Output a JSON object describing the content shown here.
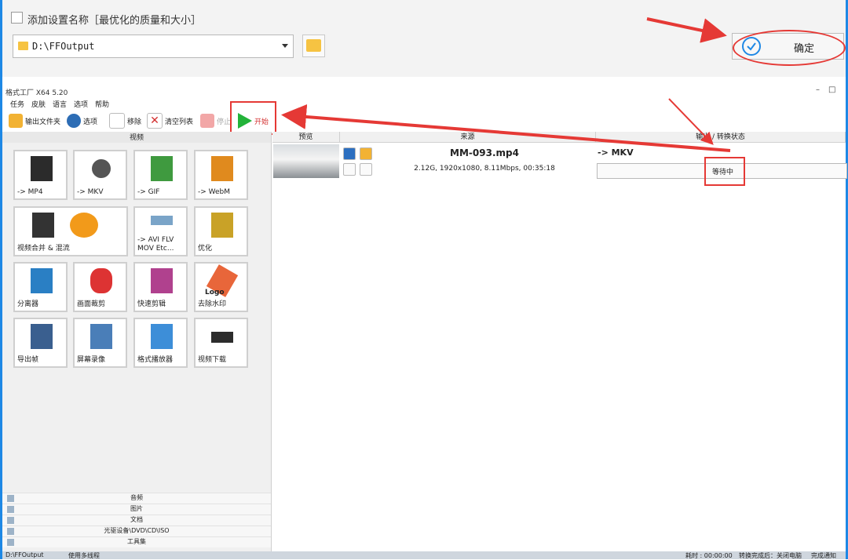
{
  "dialog": {
    "checkbox_label": "添加设置名称［最优化的质量和大小］",
    "path_value": "D:\\FFOutput",
    "ok_label": "确定"
  },
  "app": {
    "title": "格式工厂 X64 5.20",
    "win_min": "–",
    "win_max": "□",
    "menu": [
      "任务",
      "皮肤",
      "语言",
      "选项",
      "帮助"
    ],
    "toolbar": {
      "output_folder": "输出文件夹",
      "options": "选项",
      "remove": "移除",
      "clear_list": "清空列表",
      "stop": "停止",
      "start": "开始"
    },
    "left": {
      "category": "视频",
      "tiles": [
        {
          "label": "-> MP4",
          "badge": "MP4"
        },
        {
          "label": "-> MKV",
          "badge": "MKV"
        },
        {
          "label": "-> GIF",
          "badge": "GIF"
        },
        {
          "label": "-> WebM",
          "badge": "WebM"
        },
        {
          "label": "视频合并 & 混流"
        },
        {
          "label": "-> AVI FLV",
          "label2": "MOV Etc..."
        },
        {
          "label": "优化"
        },
        {
          "label": "分离器"
        },
        {
          "label": "画面裁剪"
        },
        {
          "label": "快速剪辑"
        },
        {
          "label": "去除水印",
          "badge": "Logo"
        },
        {
          "label": "导出帧"
        },
        {
          "label": "屏幕录像"
        },
        {
          "label": "格式播放器"
        },
        {
          "label": "视频下载"
        }
      ],
      "bottom_categories": [
        "音频",
        "图片",
        "文档",
        "光驱设备\\DVD\\CD\\ISO",
        "工具集"
      ]
    },
    "right": {
      "col_preview": "预览",
      "col_source": "来源",
      "col_output": "输出 / 转换状态",
      "file_name": "MM-093.mp4",
      "file_info": "2.12G, 1920x1080, 8.11Mbps, 00:35:18",
      "output_format": "-> MKV",
      "status": "等待中"
    },
    "statusbar": {
      "path": "D:\\FFOutput",
      "multithread": "使用多线程",
      "elapsed": "耗时 : 00:00:00",
      "after_convert": "转换完成后：关闭电脑",
      "notify": "完成通知"
    }
  },
  "colors": {
    "frame": "#1e88e5",
    "annotation": "#e53935",
    "play": "#23b33a"
  }
}
